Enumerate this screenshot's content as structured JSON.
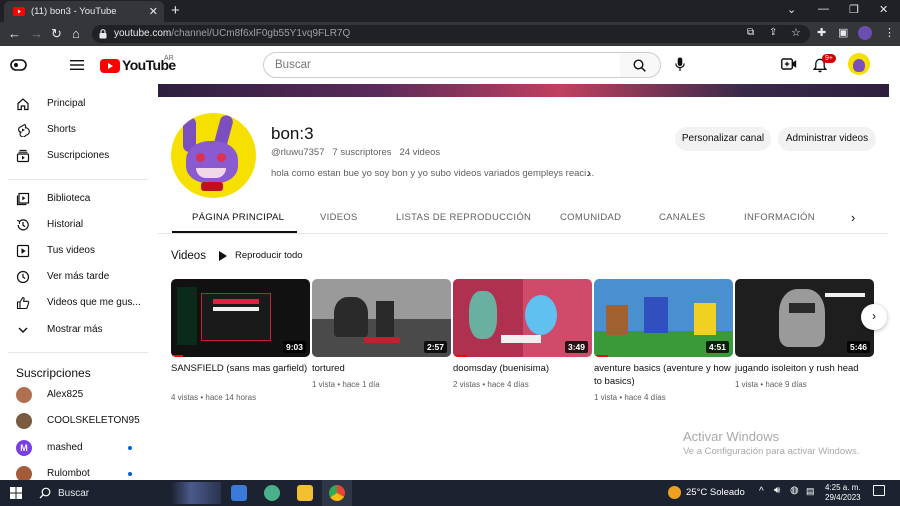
{
  "browser": {
    "tab_title": "(11) bon3 - YouTube",
    "url_host": "youtube.com",
    "url_path": "/channel/UCm8f6xlF0gb55Y1vq9FLR7Q"
  },
  "header": {
    "logo_text": "YouTube",
    "logo_region": "AR",
    "search_placeholder": "Buscar",
    "notification_count": "9+"
  },
  "sidebar": {
    "items": [
      {
        "label": "Principal",
        "icon": "home-icon"
      },
      {
        "label": "Shorts",
        "icon": "shorts-icon"
      },
      {
        "label": "Suscripciones",
        "icon": "subscriptions-icon"
      },
      {
        "label": "Biblioteca",
        "icon": "library-icon"
      },
      {
        "label": "Historial",
        "icon": "history-icon"
      },
      {
        "label": "Tus videos",
        "icon": "your-videos-icon"
      },
      {
        "label": "Ver más tarde",
        "icon": "watch-later-icon"
      },
      {
        "label": "Videos que me gus...",
        "icon": "like-icon"
      },
      {
        "label": "Mostrar más",
        "icon": "chevron-down-icon"
      }
    ],
    "subscriptions_title": "Suscripciones",
    "subscriptions": [
      {
        "name": "Alex825",
        "avatar_color": "#b07050",
        "new": false
      },
      {
        "name": "COOLSKELETON95",
        "avatar_color": "#7a5a40",
        "new": false
      },
      {
        "name": "mashed",
        "avatar_color": "#7b3fe4",
        "avatar_letter": "M",
        "new": true
      },
      {
        "name": "Rulombot",
        "avatar_color": "#a55a3a",
        "new": true
      }
    ]
  },
  "channel": {
    "name": "bon:3",
    "handle": "@rluwu7357",
    "subscribers": "7 suscriptores",
    "videos_count": "24 videos",
    "description": "hola como estan bue yo soy bon y yo subo videos variados gempleys reaci...",
    "customize_button": "Personalizar canal",
    "manage_button": "Administrar videos"
  },
  "tabs": [
    {
      "label": "PÁGINA PRINCIPAL",
      "active": true
    },
    {
      "label": "VIDEOS",
      "active": false
    },
    {
      "label": "LISTAS DE REPRODUCCIÓN",
      "active": false
    },
    {
      "label": "COMUNIDAD",
      "active": false
    },
    {
      "label": "CANALES",
      "active": false
    },
    {
      "label": "INFORMACIÓN",
      "active": false
    }
  ],
  "section": {
    "title": "Videos",
    "play_all": "Reproducir todo"
  },
  "videos": [
    {
      "title": "SANSFIELD (sans mas garfield)",
      "duration": "9:03",
      "views": "4 vistas",
      "age": "hace 14 horas",
      "watched_fraction": 0.1,
      "thumb_color": "#1a1a1a"
    },
    {
      "title": "tortured",
      "duration": "2:57",
      "views": "1 vista",
      "age": "hace 1 día",
      "watched_fraction": 0,
      "thumb_color": "#6b6b6b"
    },
    {
      "title": "doomsday (buenisima)",
      "duration": "3:49",
      "views": "2 vistas",
      "age": "hace 4 días",
      "watched_fraction": 0.1,
      "thumb_color": "#c04060"
    },
    {
      "title": "aventure basics (aventure y how to basics)",
      "duration": "4:51",
      "views": "1 vista",
      "age": "hace 4 días",
      "watched_fraction": 0.1,
      "thumb_color": "#3a7ac0"
    },
    {
      "title": "jugando isoleiton y rush head",
      "duration": "5:46",
      "views": "1 vista",
      "age": "hace 9 días",
      "watched_fraction": 0,
      "thumb_color": "#2a2a2a"
    }
  ],
  "watermark": {
    "line1": "Activar Windows",
    "line2": "Ve a Configuración para activar Windows."
  },
  "taskbar": {
    "search_label": "Buscar",
    "weather": "25°C  Soleado",
    "time": "4:25 a. m.",
    "date": "29/4/2023"
  }
}
